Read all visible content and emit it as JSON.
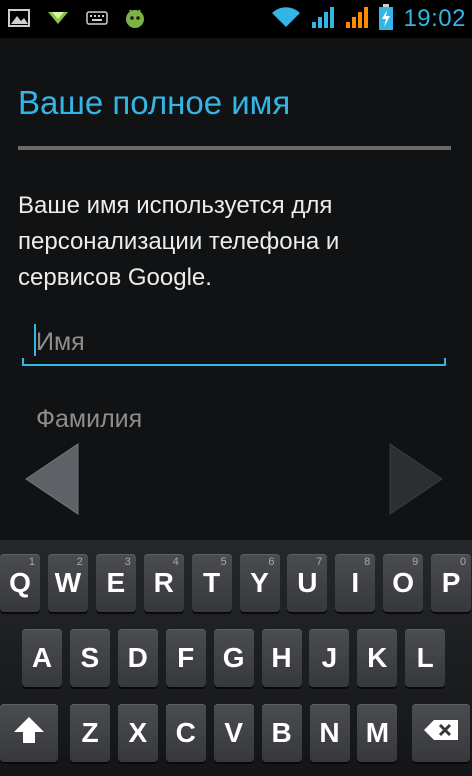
{
  "status_bar": {
    "time": "19:02",
    "icons": [
      "gallery-icon",
      "download-icon",
      "keyboard-icon",
      "android-app-icon",
      "wifi-icon",
      "signal-icon",
      "signal-orange-icon",
      "battery-charging-icon"
    ],
    "colors": {
      "accent": "#33b5e5",
      "warn": "#ff8a00"
    }
  },
  "screen": {
    "title": "Ваше полное имя",
    "description": "Ваше имя используется для персонализации телефона и сервисов Google.",
    "first_name_placeholder": "Имя",
    "last_name_placeholder": "Фамилия"
  },
  "navigation": {
    "prev_icon": "left-arrow-icon",
    "next_icon": "right-arrow-icon"
  },
  "keyboard": {
    "row1": [
      {
        "label": "Q",
        "hint": "1"
      },
      {
        "label": "W",
        "hint": "2"
      },
      {
        "label": "E",
        "hint": "3"
      },
      {
        "label": "R",
        "hint": "4"
      },
      {
        "label": "T",
        "hint": "5"
      },
      {
        "label": "Y",
        "hint": "6"
      },
      {
        "label": "U",
        "hint": "7"
      },
      {
        "label": "I",
        "hint": "8"
      },
      {
        "label": "O",
        "hint": "9"
      },
      {
        "label": "P",
        "hint": "0"
      }
    ],
    "row2": [
      "A",
      "S",
      "D",
      "F",
      "G",
      "H",
      "J",
      "K",
      "L"
    ],
    "row3": [
      "Z",
      "X",
      "C",
      "V",
      "B",
      "N",
      "M"
    ],
    "shift_icon": "shift-icon",
    "delete_icon": "backspace-icon"
  }
}
